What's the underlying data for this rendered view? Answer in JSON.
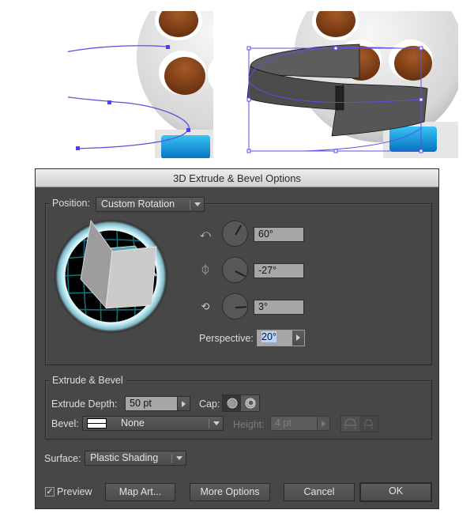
{
  "dialog": {
    "title": "3D Extrude & Bevel Options",
    "position": {
      "label": "Position:",
      "selected": "Custom Rotation",
      "rotations": [
        {
          "axis": "x-axis",
          "icon": "rotate-x-axis-icon",
          "value": "60°",
          "degrees": 60
        },
        {
          "axis": "y-axis",
          "icon": "rotate-y-axis-icon",
          "value": "-27°",
          "degrees": -27
        },
        {
          "axis": "z-axis",
          "icon": "rotate-z-axis-icon",
          "value": "3°",
          "degrees": 3
        }
      ],
      "perspective_label": "Perspective:",
      "perspective_value": "20°"
    },
    "extrude_bevel": {
      "legend": "Extrude & Bevel",
      "depth_label": "Extrude Depth:",
      "depth_value": "50 pt",
      "cap_label": "Cap:",
      "cap_options": [
        "cap-on",
        "cap-off"
      ],
      "cap_selected": "cap-on",
      "bevel_label": "Bevel:",
      "bevel_selected": "None",
      "height_label": "Height:",
      "height_value": "4 pt",
      "bevel_modes": [
        "bevel-extent-out",
        "bevel-extent-in"
      ]
    },
    "surface": {
      "label": "Surface:",
      "selected": "Plastic Shading"
    },
    "footer": {
      "preview_label": "Preview",
      "preview_checked": true,
      "map_art_label": "Map Art...",
      "more_options_label": "More Options",
      "cancel_label": "Cancel",
      "ok_label": "OK"
    }
  },
  "illustrations": {
    "left": "film-reel-with-path",
    "right": "film-reel-with-3d-extruded-ribbon"
  },
  "colors": {
    "path_stroke": "#5a52e0",
    "dialog_bg": "#474747",
    "focus_ring": "#e8902c",
    "cube_top": "#5ea3b5"
  }
}
